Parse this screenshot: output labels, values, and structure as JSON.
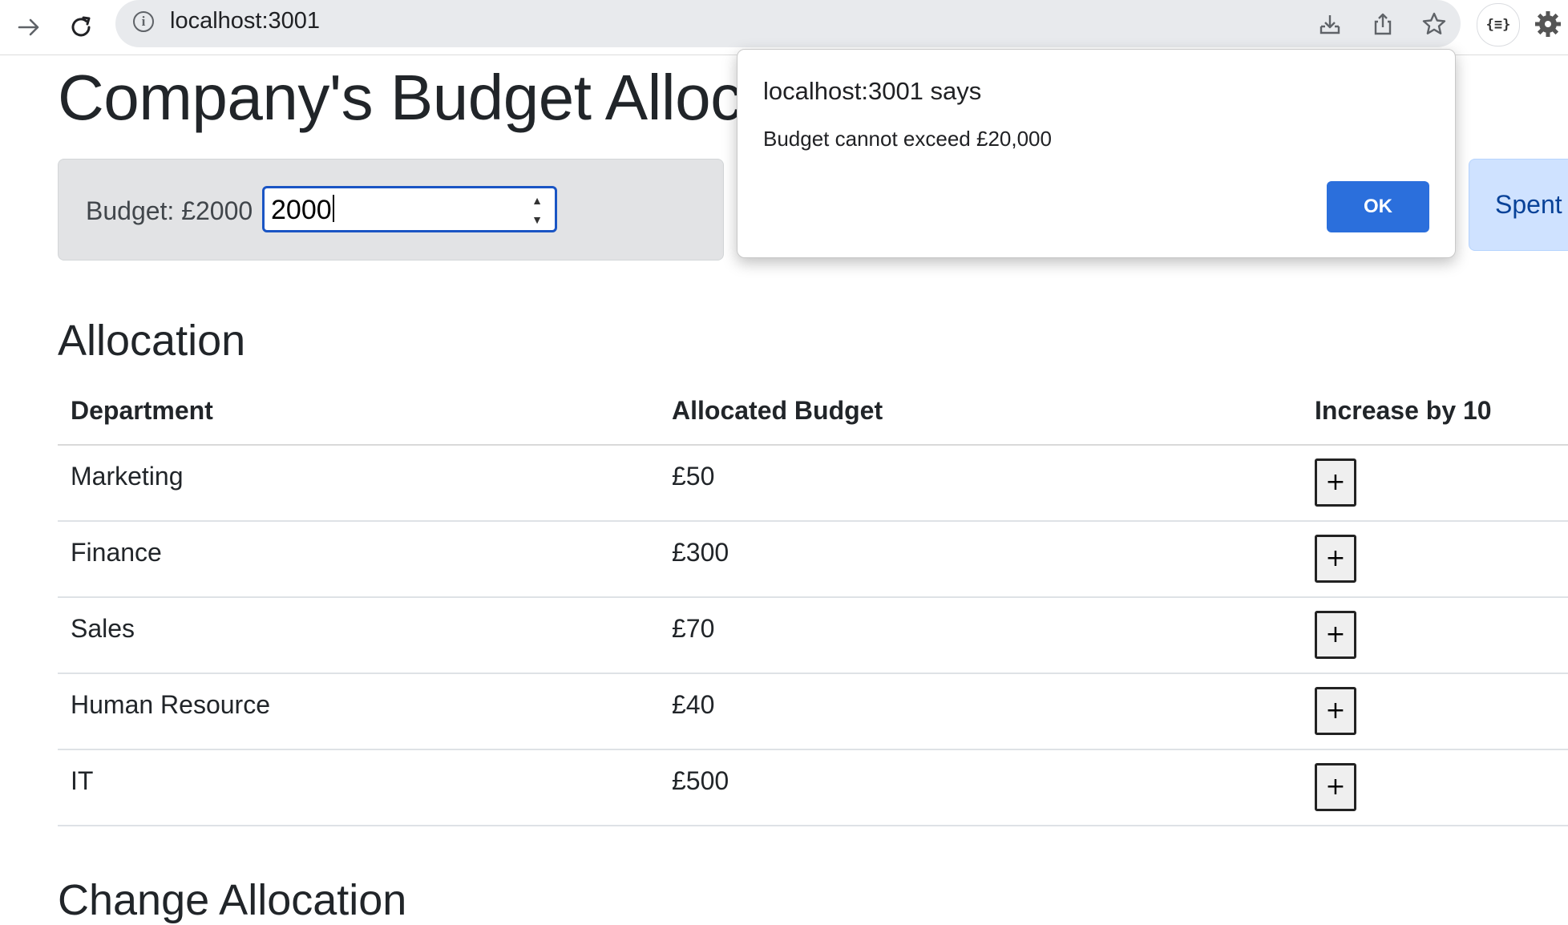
{
  "browser": {
    "url": "localhost:3001"
  },
  "page": {
    "title": "Company's Budget Alloc",
    "budget": {
      "label": "Budget: £2000",
      "input_value": "2000"
    },
    "spent": {
      "label": "Spent"
    },
    "allocation": {
      "heading": "Allocation",
      "columns": [
        "Department",
        "Allocated Budget",
        "Increase by 10"
      ],
      "rows": [
        {
          "department": "Marketing",
          "budget": "£50",
          "action": "+"
        },
        {
          "department": "Finance",
          "budget": "£300",
          "action": "+"
        },
        {
          "department": "Sales",
          "budget": "£70",
          "action": "+"
        },
        {
          "department": "Human Resource",
          "budget": "£40",
          "action": "+"
        },
        {
          "department": "IT",
          "budget": "£500",
          "action": "+"
        }
      ]
    },
    "change_allocation": {
      "heading": "Change Allocation"
    }
  },
  "dialog": {
    "title": "localhost:3001 says",
    "message": "Budget cannot exceed £20,000",
    "ok_label": "OK",
    "accent_color": "#2b6fdc"
  },
  "icons": {
    "back": "arrow-right-icon",
    "reload": "reload-icon",
    "site_info": "info-icon",
    "install": "install-icon",
    "share": "share-icon",
    "bookmark": "star-icon",
    "extension": "json-formatter-icon",
    "settings": "gear-icon"
  }
}
